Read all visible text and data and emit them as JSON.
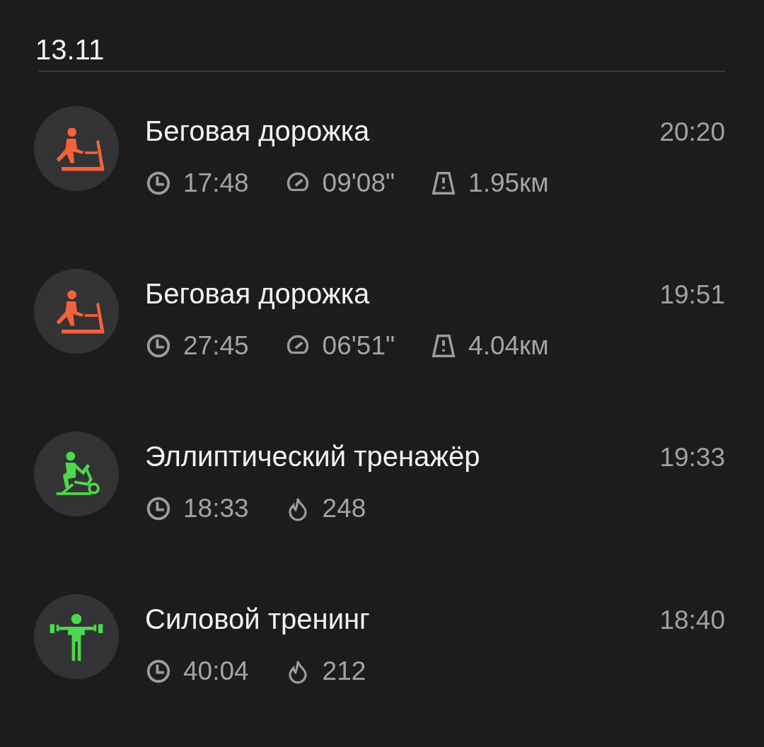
{
  "date_header": "13.11",
  "workouts": [
    {
      "kind": "treadmill",
      "color": "#f4623a",
      "title": "Беговая дорожка",
      "time": "20:20",
      "stats": [
        {
          "kind": "duration",
          "value": "17:48"
        },
        {
          "kind": "pace",
          "value": "09'08\""
        },
        {
          "kind": "distance",
          "value": "1.95км"
        }
      ]
    },
    {
      "kind": "treadmill",
      "color": "#f4623a",
      "title": "Беговая дорожка",
      "time": "19:51",
      "stats": [
        {
          "kind": "duration",
          "value": "27:45"
        },
        {
          "kind": "pace",
          "value": "06'51\""
        },
        {
          "kind": "distance",
          "value": "4.04км"
        }
      ]
    },
    {
      "kind": "elliptical",
      "color": "#4cd94c",
      "title": "Эллиптический тренажёр",
      "time": "19:33",
      "stats": [
        {
          "kind": "duration",
          "value": "18:33"
        },
        {
          "kind": "calories",
          "value": "248"
        }
      ]
    },
    {
      "kind": "strength",
      "color": "#4cd94c",
      "title": "Силовой тренинг",
      "time": "18:40",
      "stats": [
        {
          "kind": "duration",
          "value": "40:04"
        },
        {
          "kind": "calories",
          "value": "212"
        }
      ]
    }
  ]
}
